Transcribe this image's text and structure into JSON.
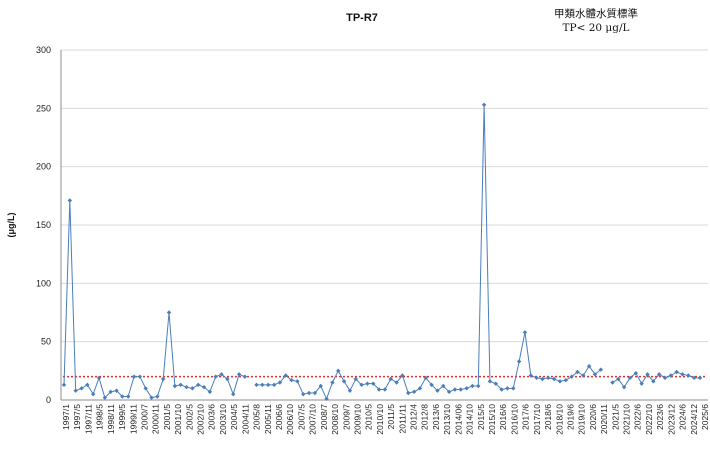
{
  "chart_data": {
    "type": "line",
    "title": "TP-R7",
    "standard_note_line1": "甲類水體水質標準",
    "standard_note_line2": "TP< 20 μg/L",
    "ylabel": "(μg/L)",
    "xlabel": "",
    "ylim": [
      0,
      300
    ],
    "y_ticks": [
      0,
      50,
      100,
      150,
      200,
      250,
      300
    ],
    "grid": true,
    "standard_value": 20,
    "series_color": "#4a7ebb",
    "standard_color": "#e03030",
    "x_labels": [
      "1997/1",
      "1997/5",
      "1997/11",
      "1998/5",
      "1998/11",
      "1999/5",
      "1999/11",
      "2000/7",
      "2000/11",
      "2001/5",
      "2001/10",
      "2002/5",
      "2002/10",
      "2003/6",
      "2003/10",
      "2004/5",
      "2004/11",
      "2005/8",
      "2005/11",
      "2006/6",
      "2006/10",
      "2007/5",
      "2007/10",
      "2008/7",
      "2008/10",
      "2009/7",
      "2009/10",
      "2010/5",
      "2010/10",
      "2011/5",
      "2011/11",
      "2012/4",
      "2012/8",
      "2013/6",
      "2013/10",
      "2014/06",
      "2014/10",
      "2015/5",
      "2015/10",
      "2016/6",
      "2016/10",
      "2017/6",
      "2017/10",
      "2018/6",
      "2018/10",
      "2019/6",
      "2019/10",
      "2020/6",
      "2020/11",
      "2021/5",
      "2021/10",
      "2022/6",
      "2022/10",
      "2023/6",
      "2023/12",
      "2024/6",
      "2024/12",
      "2025/6"
    ],
    "series": [
      {
        "values": [
          13,
          171,
          8,
          10,
          13,
          5,
          19,
          2,
          7,
          8,
          3,
          3,
          20,
          20,
          10,
          2,
          3,
          18,
          75,
          12,
          13,
          11,
          10,
          13,
          11,
          7,
          20,
          22,
          18,
          5,
          22,
          20,
          null,
          13,
          13,
          13,
          13,
          15,
          21,
          17,
          16,
          5,
          6,
          6,
          12,
          1,
          15,
          25,
          16,
          8,
          18,
          13,
          14,
          14,
          9,
          9,
          18,
          15,
          21,
          6,
          7,
          10,
          19,
          13,
          8,
          12,
          7,
          9,
          9,
          10,
          12,
          12,
          253,
          16,
          14,
          9,
          10,
          10,
          33,
          58,
          21,
          19,
          18,
          19,
          18,
          16,
          17,
          20,
          24,
          21,
          29,
          22,
          26,
          null,
          15,
          18,
          11,
          19,
          23,
          14,
          22,
          16,
          22,
          19,
          21,
          24,
          22,
          21,
          19,
          19
        ]
      }
    ]
  }
}
